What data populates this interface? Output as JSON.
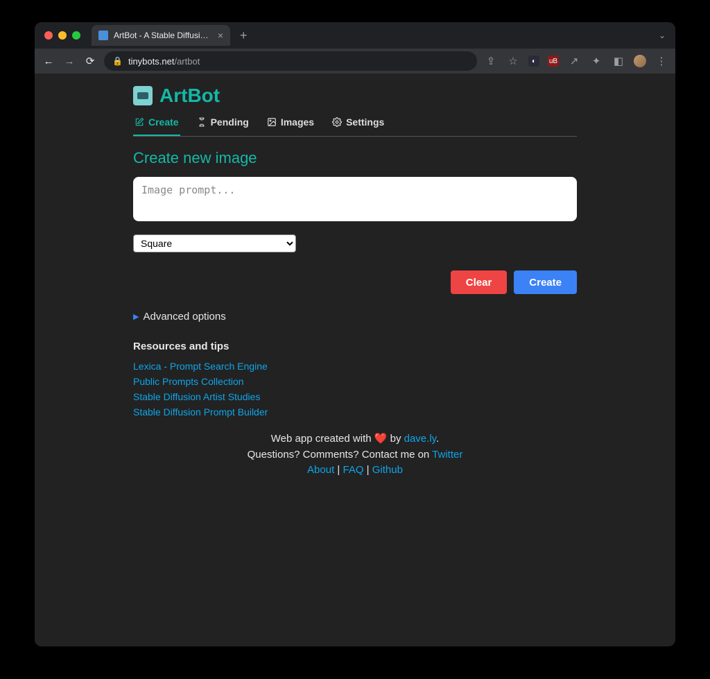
{
  "browser": {
    "tab_title": "ArtBot - A Stable Diffusion dem",
    "url_host": "tinybots.net",
    "url_path": "/artbot"
  },
  "brand": {
    "title": "ArtBot"
  },
  "nav": {
    "create": "Create",
    "pending": "Pending",
    "images": "Images",
    "settings": "Settings"
  },
  "heading": "Create new image",
  "prompt": {
    "placeholder": "Image prompt..."
  },
  "size_select": {
    "value": "Square"
  },
  "buttons": {
    "clear": "Clear",
    "create": "Create"
  },
  "advanced": "Advanced options",
  "resources": {
    "title": "Resources and tips",
    "links": {
      "0": "Lexica - Prompt Search Engine",
      "1": "Public Prompts Collection",
      "2": "Stable Diffusion Artist Studies",
      "3": "Stable Diffusion Prompt Builder"
    }
  },
  "footer": {
    "line1_a": "Web app created with ",
    "line1_b": " by ",
    "author": "dave.ly",
    "line1_c": ".",
    "line2_a": "Questions? Comments? Contact me on ",
    "twitter": "Twitter",
    "about": "About",
    "faq": "FAQ",
    "github": "Github",
    "sep": " | "
  }
}
